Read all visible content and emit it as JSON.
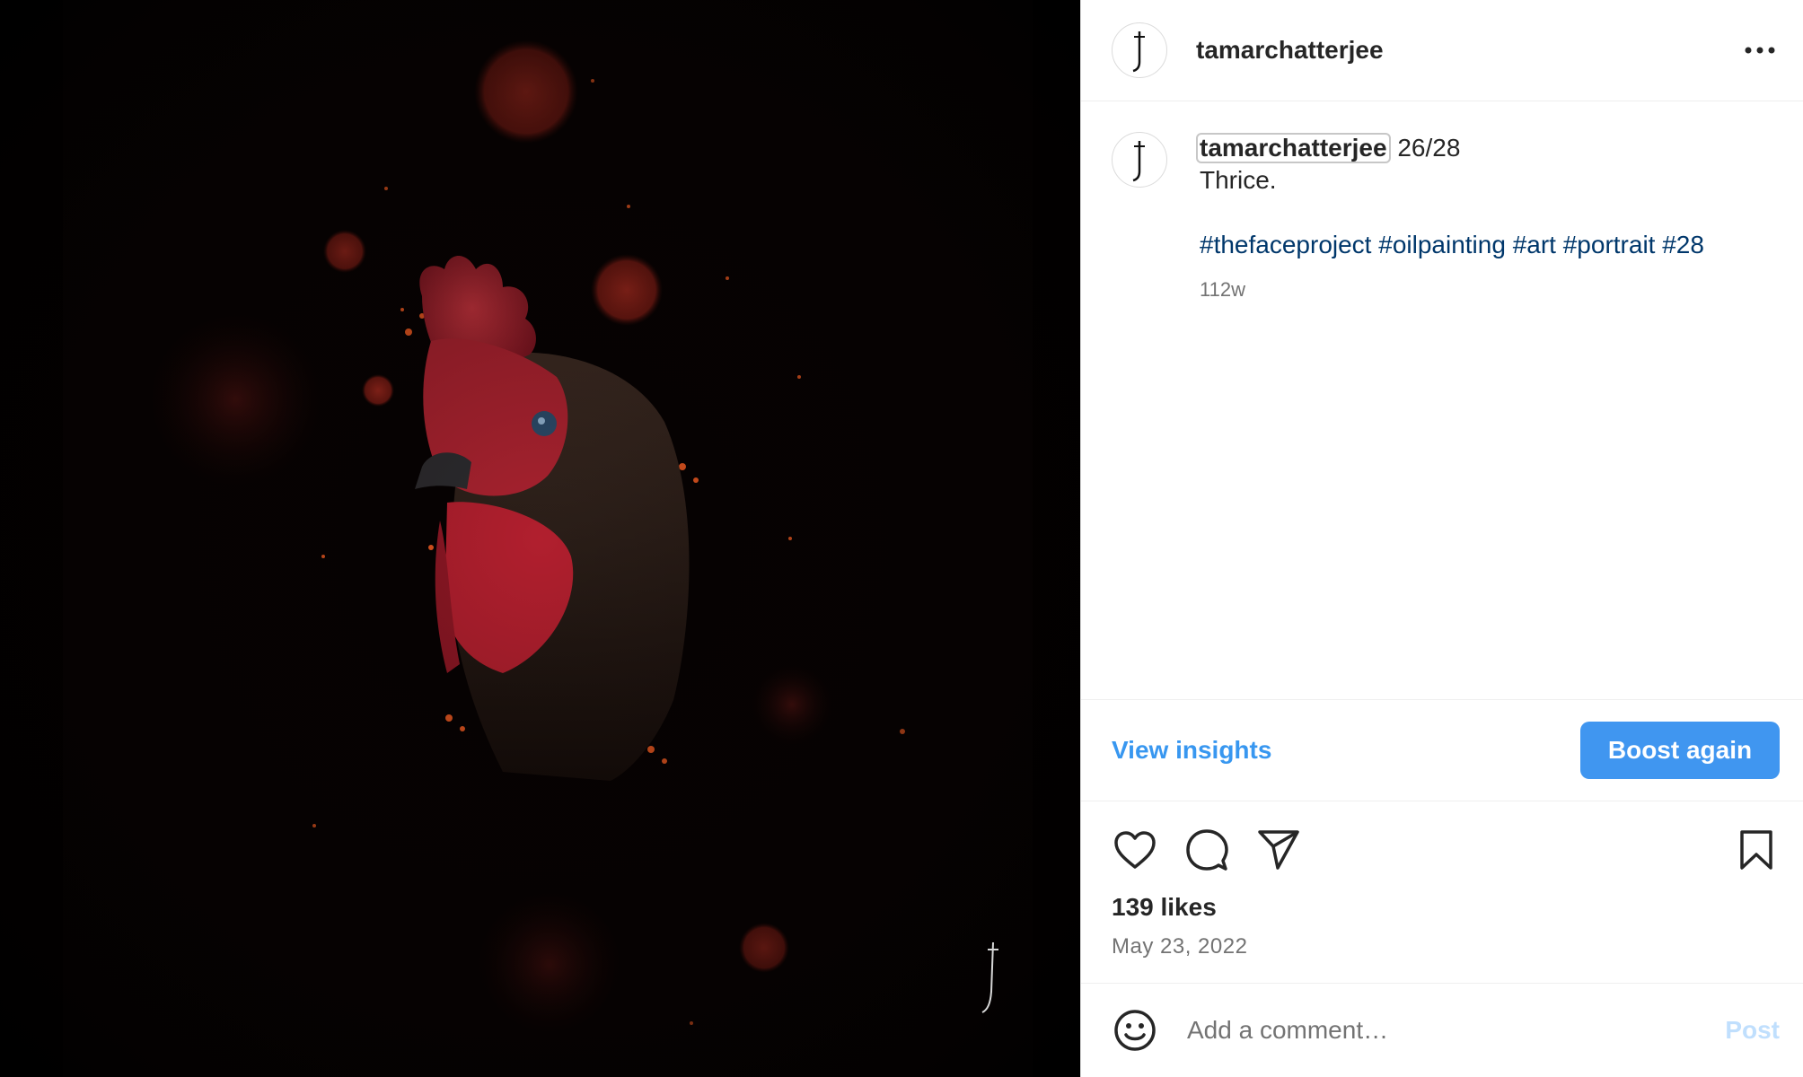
{
  "post": {
    "username": "tamarchatterjee",
    "image_alt": "Painting of a rooster with red comb against a dark background with red bokeh and ember sparks",
    "caption_counter": "26/28",
    "caption_text": "Thrice.",
    "hashtags": [
      "#thefaceproject",
      "#oilpainting",
      "#art",
      "#portrait",
      "#28"
    ],
    "age": "112w",
    "likes": "139 likes",
    "date": "May 23, 2022"
  },
  "actions": {
    "view_insights": "View insights",
    "boost_again": "Boost again"
  },
  "comment": {
    "placeholder": "Add a comment…",
    "post_label": "Post"
  },
  "icons": {
    "more": "more-options-icon",
    "like": "heart-icon",
    "comment": "comment-bubble-icon",
    "share": "paper-plane-icon",
    "save": "bookmark-icon",
    "emoji": "emoji-smile-icon"
  },
  "colors": {
    "link": "#3897f0",
    "hashtag": "#00376b",
    "boost_button": "#4096f0",
    "post_disabled": "#c0dffd",
    "secondary_text": "#737373"
  }
}
